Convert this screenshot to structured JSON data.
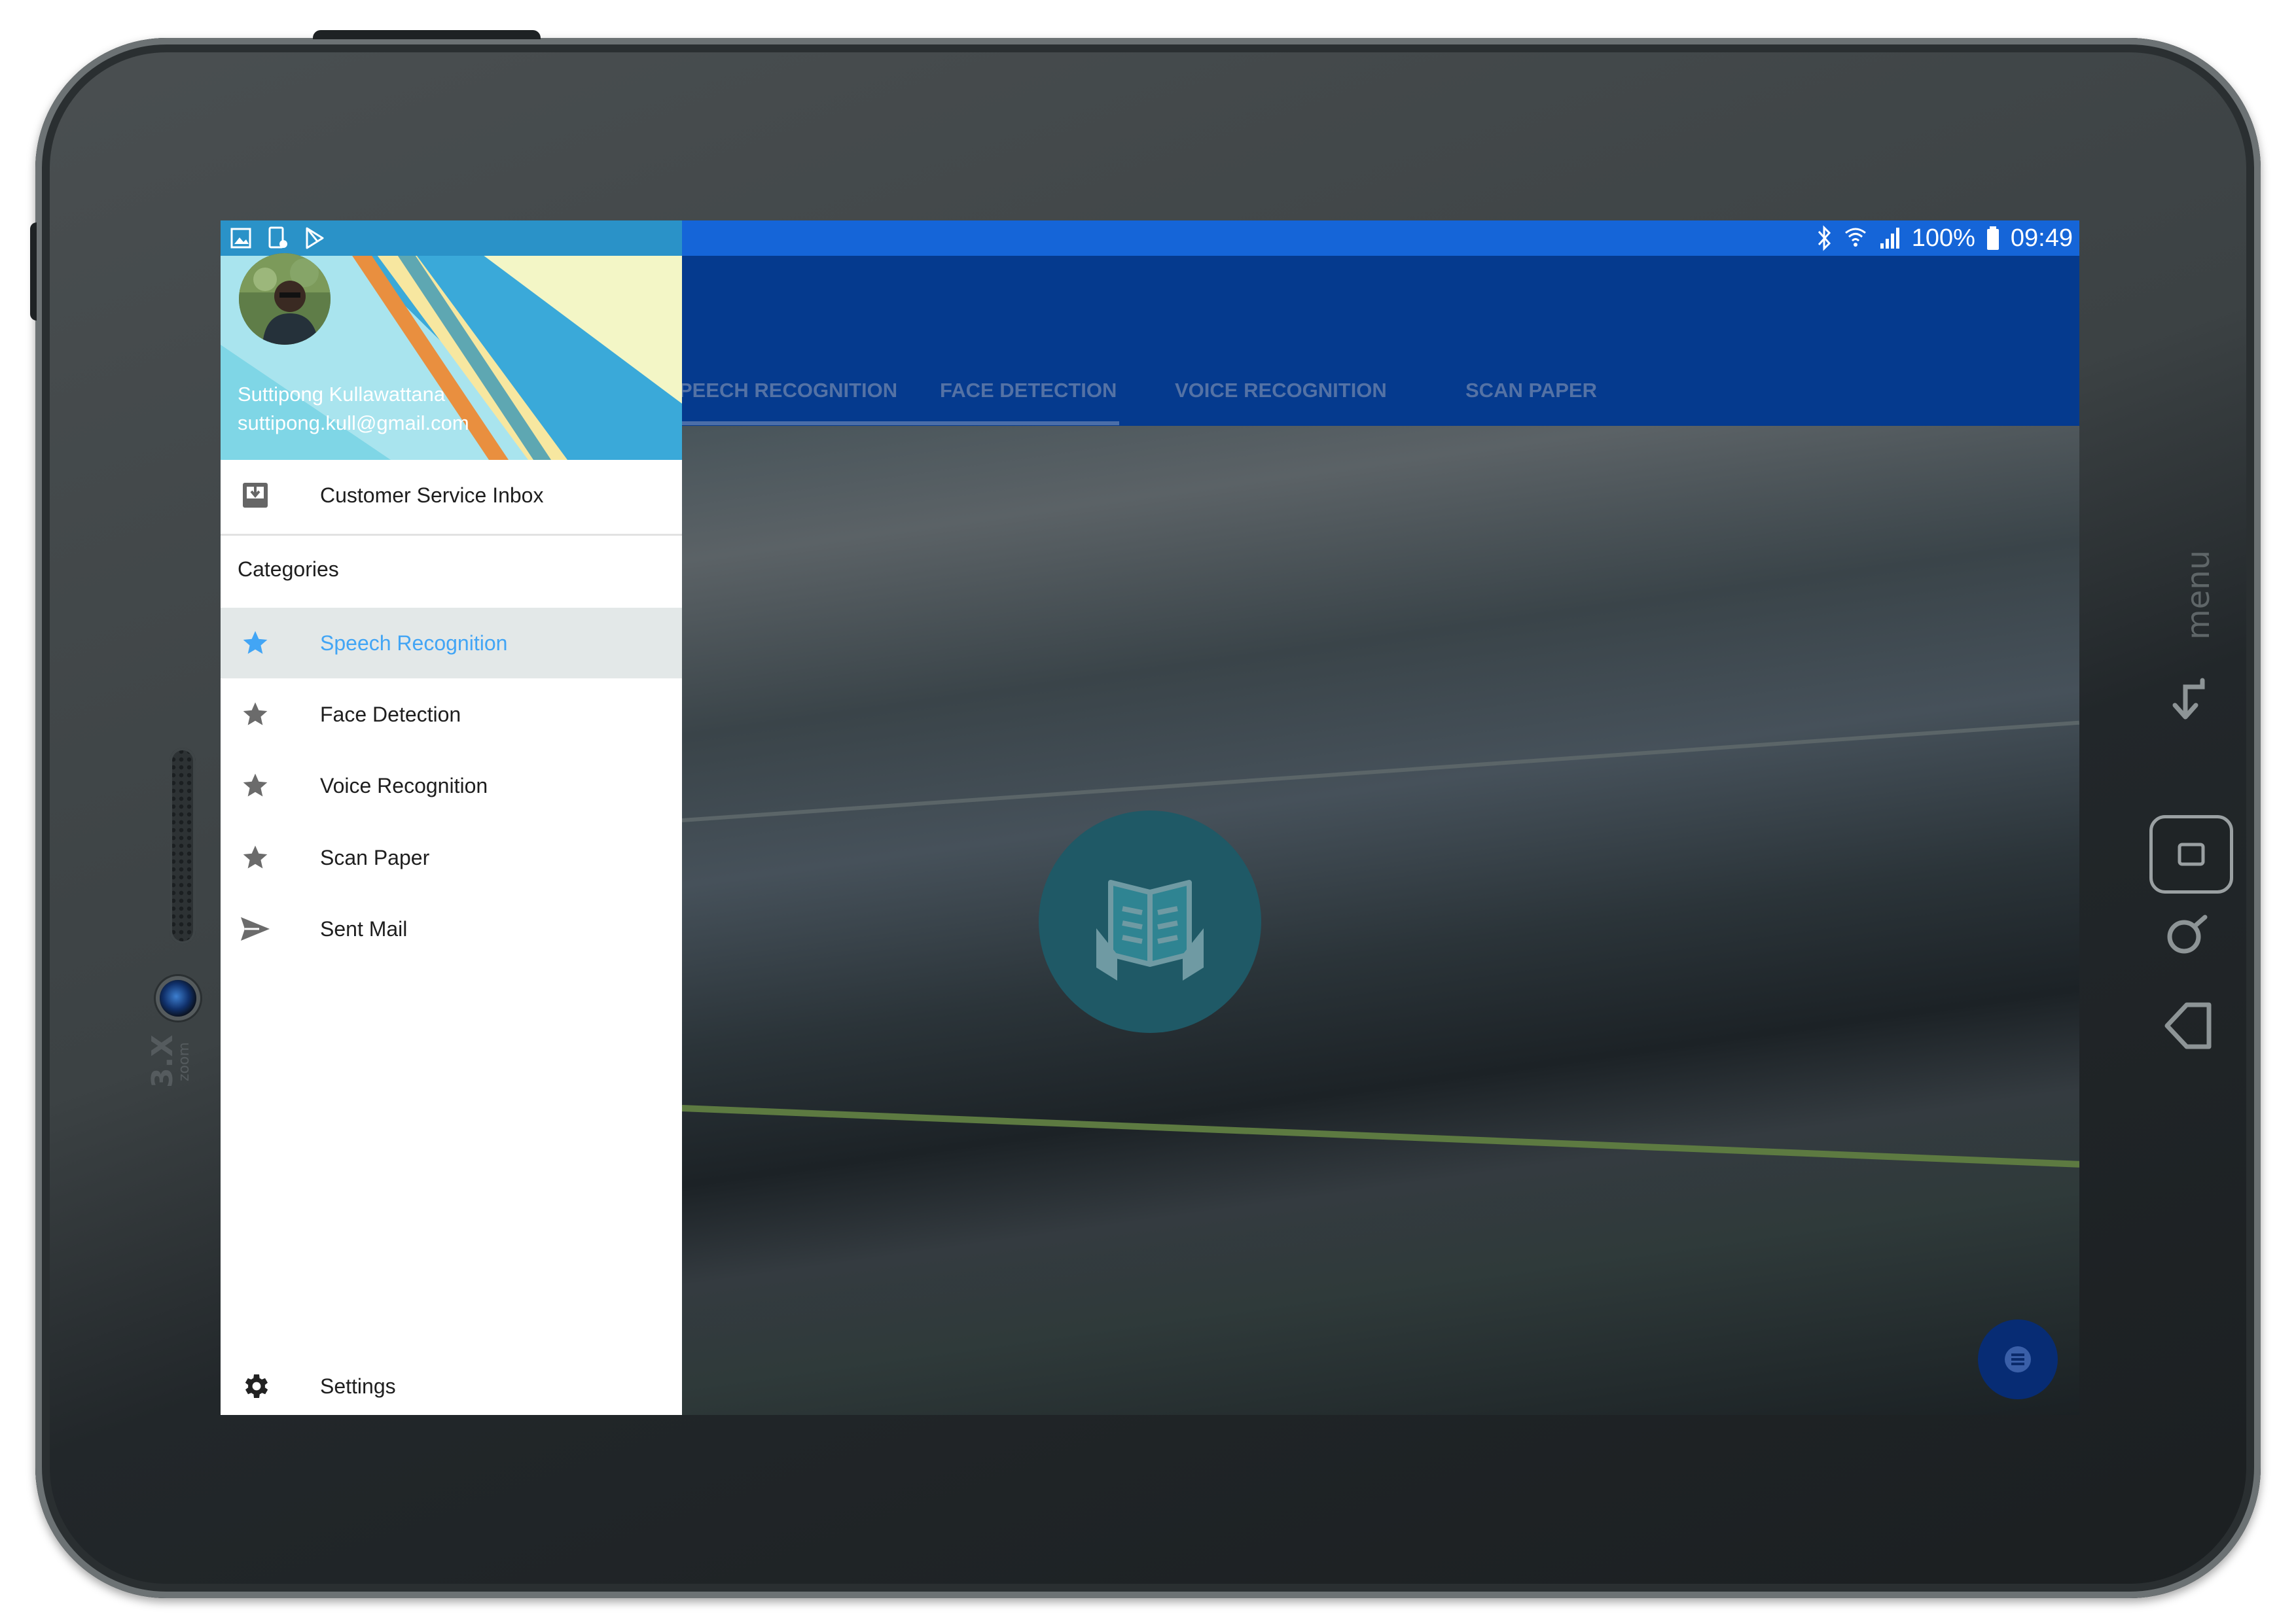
{
  "statusbar": {
    "battery": "100%",
    "time": "09:49",
    "left_icons": [
      "gallery-icon",
      "screenshot-icon",
      "play-store-icon"
    ],
    "right_icons": [
      "bluetooth-icon",
      "wifi-icon",
      "signal-icon",
      "battery-icon"
    ]
  },
  "tabs": [
    {
      "label": "PEECH RECOGNITION",
      "selected": true
    },
    {
      "label": "FACE DETECTION",
      "selected": false
    },
    {
      "label": "VOICE RECOGNITION",
      "selected": false
    },
    {
      "label": "SCAN PAPER",
      "selected": false
    }
  ],
  "drawer": {
    "user_name": "Suttipong Kullawattana",
    "user_email": "suttipong.kull@gmail.com",
    "inbox_label": "Customer Service Inbox",
    "section_label": "Categories",
    "items": [
      {
        "label": "Speech Recognition",
        "icon": "star-icon",
        "selected": true
      },
      {
        "label": "Face Detection",
        "icon": "star-icon",
        "selected": false
      },
      {
        "label": "Voice Recognition",
        "icon": "star-icon",
        "selected": false
      },
      {
        "label": "Scan Paper",
        "icon": "star-icon",
        "selected": false
      },
      {
        "label": "Sent Mail",
        "icon": "send-icon",
        "selected": false
      }
    ],
    "settings_label": "Settings"
  },
  "device": {
    "zoom_big": "3.X",
    "zoom_small": "zoom",
    "menu_label": "menu"
  },
  "colors": {
    "statusbar": "#1565d8",
    "appbar": "#053a8e",
    "accent": "#42a5f5",
    "selected_row": "#e3e8e8",
    "fab": "#1f5966"
  }
}
